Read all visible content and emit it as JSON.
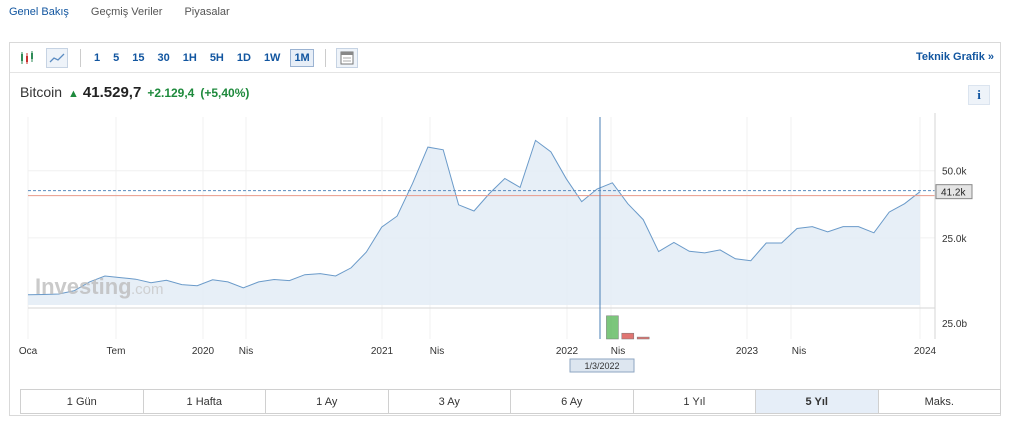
{
  "nav": [
    "Genel Bakış",
    "Geçmiş Veriler",
    "Piyasalar"
  ],
  "toolbar": {
    "ranges": [
      "1",
      "5",
      "15",
      "30",
      "1H",
      "5H",
      "1D",
      "1W",
      "1M"
    ],
    "active_range": "1M",
    "tech_link": "Teknik Grafik »"
  },
  "headline": {
    "name": "Bitcoin",
    "price": "41.529,7",
    "change": "+2.129,4",
    "change_pct": "(+5,40%)",
    "info": "i"
  },
  "watermark": {
    "brand": "Investing",
    "suffix": ".com"
  },
  "tabs": [
    "1 Gün",
    "1 Hafta",
    "1 Ay",
    "3 Ay",
    "6 Ay",
    "1 Yıl",
    "5 Yıl",
    "Maks."
  ],
  "active_tab": "5 Yıl",
  "colors": {
    "line": "#6a9ac9",
    "fill": "#e3ecf6",
    "up": "#1e8a3c",
    "accent": "#1256a0",
    "vol_down": "#d9534f",
    "vol_up": "#5cb85c"
  },
  "chart_data": {
    "type": "area",
    "x_start": "2019-01",
    "x_step": "month",
    "values": [
      3.8,
      3.9,
      4.1,
      5.3,
      8.6,
      10.8,
      10.2,
      9.6,
      8.3,
      9.2,
      7.6,
      7.2,
      9.4,
      8.6,
      6.4,
      8.6,
      9.5,
      9.1,
      11.3,
      11.7,
      10.8,
      13.8,
      19.7,
      29.0,
      33.1,
      45.2,
      58.8,
      57.8,
      37.3,
      35.0,
      41.5,
      47.1,
      43.8,
      61.3,
      57.0,
      47.0,
      38.5,
      43.2,
      45.5,
      37.7,
      31.8,
      19.9,
      23.3,
      20.0,
      19.4,
      20.5,
      17.2,
      16.5,
      23.1,
      23.1,
      28.5,
      29.2,
      27.2,
      29.2,
      29.2,
      26.9,
      34.6,
      37.7,
      42.2
    ],
    "volumes": [
      0,
      0,
      0,
      0,
      0,
      0,
      0,
      0,
      0,
      0,
      0,
      0,
      0,
      0,
      0,
      0,
      0,
      0,
      0,
      0,
      0,
      0,
      0,
      0,
      0,
      0,
      0,
      0,
      0,
      0,
      0,
      0,
      0,
      0,
      0,
      0,
      0,
      0,
      24.0,
      6.0,
      2.0,
      0,
      0,
      0,
      0,
      0,
      0,
      0,
      0,
      0,
      0,
      0,
      0,
      0,
      0,
      0,
      0,
      0,
      0
    ],
    "x_ticks": [
      "Oca",
      "Tem",
      "2020",
      "Nis",
      "2021",
      "Nis",
      "2022",
      "Nis",
      "2023",
      "Nis",
      "2024"
    ],
    "y_ticks": [
      "50.0k",
      "25.0k"
    ],
    "last_value_label": "41.2k",
    "volume_tick": "25.0b",
    "crosshair_label": "1/3/2022",
    "ylim": [
      0,
      70
    ],
    "grid": true
  }
}
